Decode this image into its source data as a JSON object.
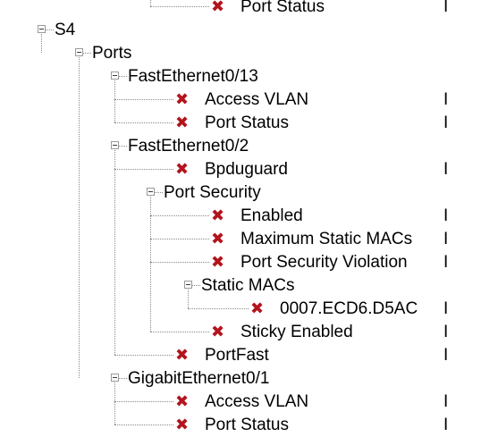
{
  "tree": [
    {
      "id": "port-status-top",
      "label": "Port Status",
      "depth": 4,
      "kind": "leaf",
      "status": "error",
      "value": "I"
    },
    {
      "id": "s4",
      "label": "S4",
      "depth": 0,
      "kind": "expanded"
    },
    {
      "id": "ports",
      "label": "Ports",
      "depth": 1,
      "kind": "expanded"
    },
    {
      "id": "fe013",
      "label": "FastEthernet0/13",
      "depth": 2,
      "kind": "expanded"
    },
    {
      "id": "fe013-access-vlan",
      "label": "Access VLAN",
      "depth": 3,
      "kind": "leaf",
      "status": "error",
      "value": "I"
    },
    {
      "id": "fe013-port-status",
      "label": "Port Status",
      "depth": 3,
      "kind": "leaf",
      "status": "error",
      "value": "I"
    },
    {
      "id": "fe02",
      "label": "FastEthernet0/2",
      "depth": 2,
      "kind": "expanded"
    },
    {
      "id": "fe02-bpduguard",
      "label": "Bpduguard",
      "depth": 3,
      "kind": "leaf",
      "status": "error",
      "value": "I"
    },
    {
      "id": "fe02-port-security",
      "label": "Port Security",
      "depth": 3,
      "kind": "expanded"
    },
    {
      "id": "ps-enabled",
      "label": "Enabled",
      "depth": 4,
      "kind": "leaf",
      "status": "error",
      "value": "I"
    },
    {
      "id": "ps-max-static-macs",
      "label": "Maximum Static MACs",
      "depth": 4,
      "kind": "leaf",
      "status": "error",
      "value": "I"
    },
    {
      "id": "ps-violation",
      "label": "Port Security Violation",
      "depth": 4,
      "kind": "leaf",
      "status": "error",
      "value": "I"
    },
    {
      "id": "ps-static-macs",
      "label": "Static MACs",
      "depth": 4,
      "kind": "expanded"
    },
    {
      "id": "mac-0007",
      "label": "0007.ECD6.D5AC",
      "depth": 5,
      "kind": "leaf",
      "status": "error",
      "value": "I"
    },
    {
      "id": "ps-sticky",
      "label": "Sticky Enabled",
      "depth": 4,
      "kind": "leaf",
      "status": "error",
      "value": "I"
    },
    {
      "id": "fe02-portfast",
      "label": "PortFast",
      "depth": 3,
      "kind": "leaf",
      "status": "error",
      "value": "I"
    },
    {
      "id": "gi01",
      "label": "GigabitEthernet0/1",
      "depth": 2,
      "kind": "expanded"
    },
    {
      "id": "gi01-access-vlan",
      "label": "Access VLAN",
      "depth": 3,
      "kind": "leaf",
      "status": "error",
      "value": "I"
    },
    {
      "id": "gi01-port-status",
      "label": "Port Status",
      "depth": 3,
      "kind": "leaf",
      "status": "error",
      "value": "I"
    }
  ],
  "icons": {
    "error": "x-mark-icon",
    "expanded": "minus-expander-icon"
  },
  "colors": {
    "error_mark": "#b3141d",
    "guide_line": "#8a8a8a",
    "text": "#000000",
    "background": "#ffffff"
  }
}
